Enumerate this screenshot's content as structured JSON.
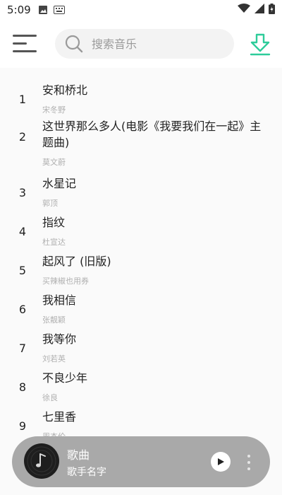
{
  "status_bar": {
    "time": "5:09"
  },
  "search": {
    "placeholder": "搜索音乐"
  },
  "songs": [
    {
      "num": "1",
      "title": "安和桥北",
      "artist": "宋冬野"
    },
    {
      "num": "2",
      "title": "这世界那么多人(电影《我要我们在一起》主题曲)",
      "artist": "莫文蔚"
    },
    {
      "num": "3",
      "title": "水星记",
      "artist": "郭顶"
    },
    {
      "num": "4",
      "title": "指纹",
      "artist": "杜宣达"
    },
    {
      "num": "5",
      "title": "起风了 (旧版)",
      "artist": "买辣椒也用券"
    },
    {
      "num": "6",
      "title": "我相信",
      "artist": "张靓颖"
    },
    {
      "num": "7",
      "title": "我等你",
      "artist": "刘若英"
    },
    {
      "num": "8",
      "title": "不良少年",
      "artist": "徐良"
    },
    {
      "num": "9",
      "title": "七里香",
      "artist": "周杰伦"
    }
  ],
  "player": {
    "title": "歌曲",
    "artist": "歌手名字"
  },
  "colors": {
    "accent": "#2ecc9a",
    "player_bg": "#a9a9a9",
    "list_bg": "#fafafa"
  }
}
